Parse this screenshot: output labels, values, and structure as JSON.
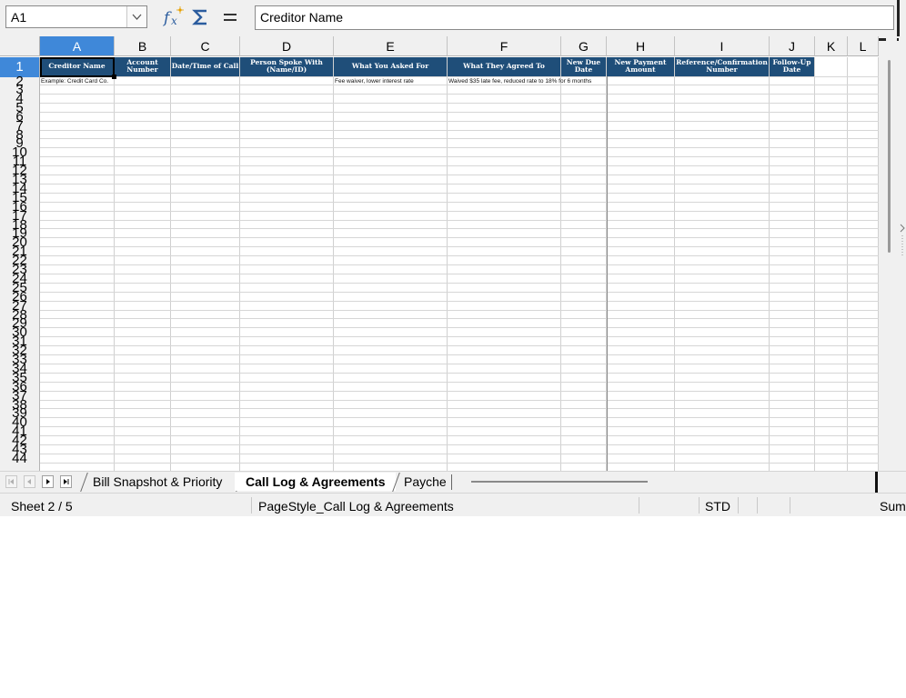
{
  "formula_bar": {
    "cell_reference": "A1",
    "formula_text": "Creditor Name"
  },
  "columns": [
    "A",
    "B",
    "C",
    "D",
    "E",
    "F",
    "G",
    "H",
    "I",
    "J",
    "K",
    "L"
  ],
  "rows": [
    "1",
    "2",
    "3",
    "4",
    "5",
    "6",
    "7",
    "8",
    "9",
    "10",
    "11",
    "12",
    "13",
    "14",
    "15",
    "16",
    "17",
    "18",
    "19",
    "20",
    "21",
    "22",
    "23",
    "24",
    "25",
    "26",
    "27",
    "28",
    "29",
    "30",
    "31",
    "32",
    "33",
    "34",
    "35",
    "36",
    "37",
    "38",
    "39",
    "40",
    "41",
    "42",
    "43",
    "44"
  ],
  "header_cells": {
    "A": "Creditor Name",
    "B": "Account Number",
    "C": "Date/Time of Call",
    "D": "Person Spoke With (Name/ID)",
    "E": "What You Asked For",
    "F": "What They Agreed To",
    "G": "New Due Date",
    "H": "New Payment Amount",
    "I": "Reference/Confirmation Number",
    "J": "Follow-Up Date"
  },
  "example_row": {
    "A": "Example: Credit Card Co.",
    "E": "Fee waiver, lower interest rate",
    "F": "Waived $35 late fee, reduced rate to 18% for 6 months"
  },
  "sheet_tabs": [
    {
      "label": "Bill Snapshot & Priority",
      "active": false
    },
    {
      "label": "Call Log & Agreements",
      "active": true
    },
    {
      "label": "Payche",
      "active": false
    }
  ],
  "status_bar": {
    "sheet_position": "Sheet 2 / 5",
    "page_style": "PageStyle_Call Log & Agreements",
    "selection_mode": "STD",
    "sum_label": "Sum"
  },
  "colors": {
    "header_fill": "#1f4e79",
    "selection_highlight": "#3f88d9",
    "chrome_background": "#f0f0f0"
  },
  "icons": [
    "function-wizard-icon",
    "sum-icon",
    "formula-equals-icon",
    "dropdown-chevron-icon"
  ]
}
